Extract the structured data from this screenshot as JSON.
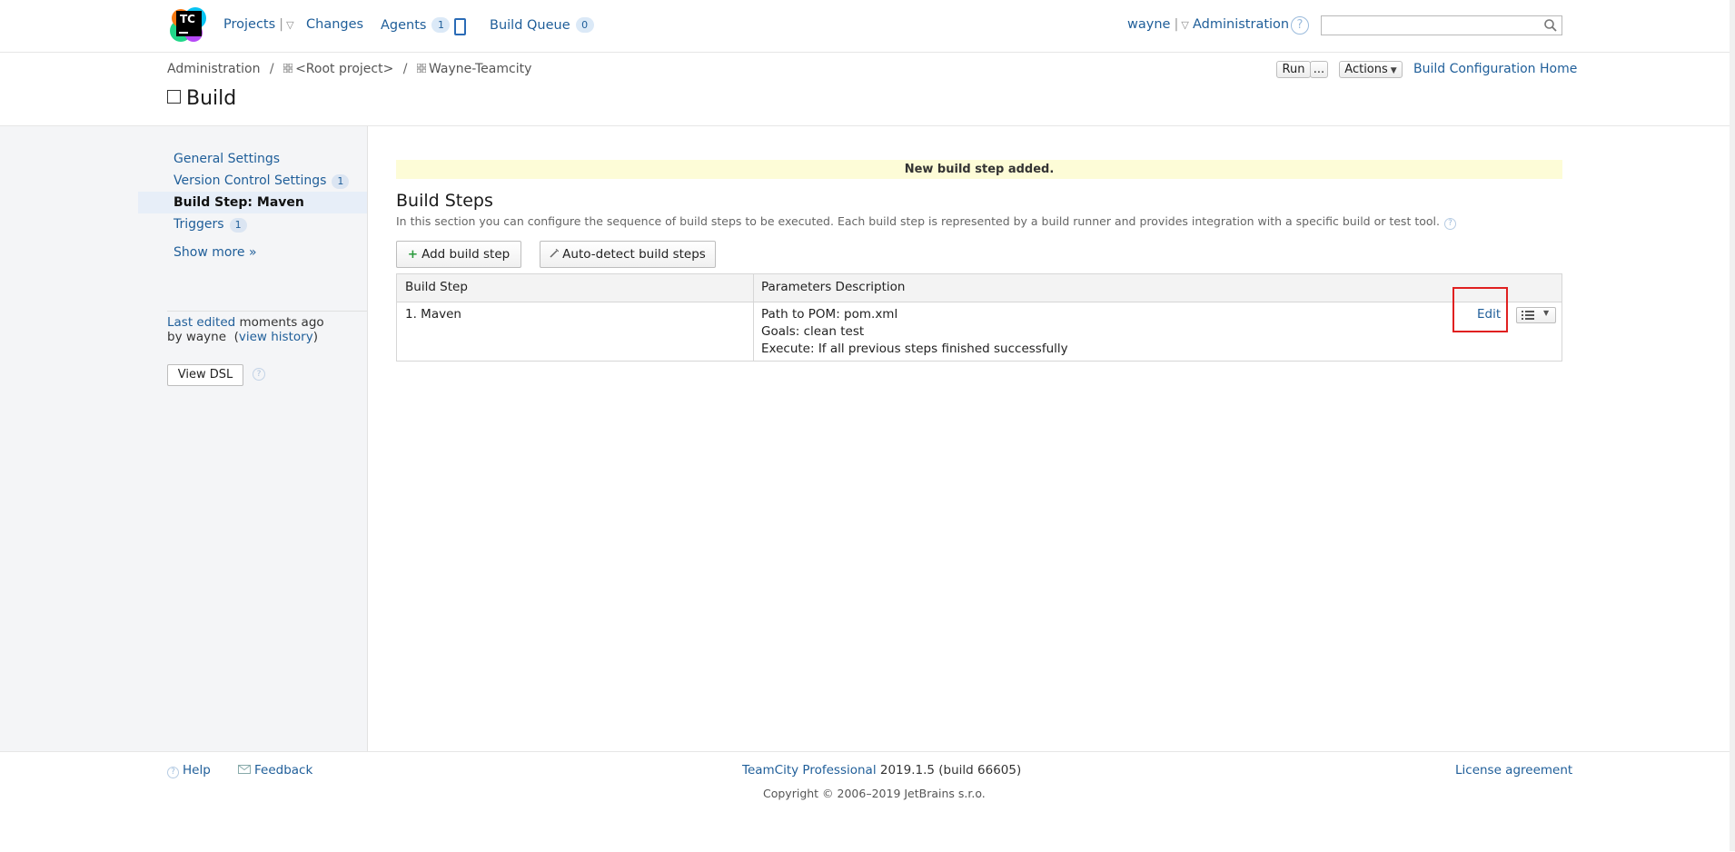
{
  "header": {
    "logo_text": "TC",
    "nav": {
      "projects": "Projects",
      "changes": "Changes",
      "agents": "Agents",
      "agents_count": "1",
      "build_queue": "Build Queue",
      "build_queue_count": "0"
    },
    "user": "wayne",
    "administration": "Administration",
    "search": {
      "placeholder": "",
      "value": ""
    }
  },
  "breadcrumb": {
    "items": [
      "Administration",
      "<Root project>",
      "Wayne-Teamcity"
    ]
  },
  "page": {
    "title": "Build",
    "run_label": "Run",
    "run_more_label": "...",
    "actions_label": "Actions",
    "config_home_label": "Build Configuration Home"
  },
  "sidebar": {
    "items": [
      {
        "label": "General Settings",
        "count": ""
      },
      {
        "label": "Version Control Settings",
        "count": "1"
      },
      {
        "label": "Build Step: Maven",
        "count": ""
      },
      {
        "label": "Triggers",
        "count": "1"
      }
    ],
    "show_more": "Show more »",
    "last_edited_label": "Last edited",
    "last_edited_time": "moments ago",
    "by_prefix": "by wayne",
    "view_history": "view history",
    "view_dsl": "View DSL"
  },
  "main": {
    "banner": "New build step added.",
    "section_title": "Build Steps",
    "section_desc": "In this section you can configure the sequence of build steps to be executed. Each build step is represented by a build runner and provides integration with a specific build or test tool.",
    "add_step_label": "Add build step",
    "auto_detect_label": "Auto-detect build steps",
    "table": {
      "headers": [
        "Build Step",
        "Parameters Description"
      ],
      "rows": [
        {
          "step": "1. Maven",
          "params": [
            "Path to POM: pom.xml",
            "Goals: clean test",
            "Execute: If all previous steps finished successfully"
          ],
          "edit_label": "Edit"
        }
      ]
    }
  },
  "footer": {
    "help": "Help",
    "feedback": "Feedback",
    "product": "TeamCity Professional",
    "version": "2019.1.5 (build 66605)",
    "copyright": "Copyright © 2006–2019 JetBrains s.r.o.",
    "license": "License agreement"
  },
  "colors": {
    "link": "#1f5e99",
    "banner_bg": "#fdfcd7",
    "sidebar_bg": "#f4f5f7",
    "highlight_border": "#e02020"
  }
}
